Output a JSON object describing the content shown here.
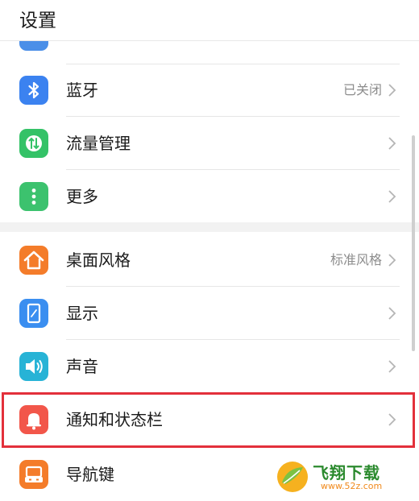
{
  "header": {
    "title": "设置"
  },
  "rows": [
    {
      "label": "蓝牙",
      "value": "已关闭",
      "icon": "bluetooth-icon",
      "color": "#3b82f0"
    },
    {
      "label": "流量管理",
      "value": "",
      "icon": "data-traffic-icon",
      "color": "#34c267"
    },
    {
      "label": "更多",
      "value": "",
      "icon": "more-dots-icon",
      "color": "#3cc26e"
    },
    {
      "label": "桌面风格",
      "value": "标准风格",
      "icon": "home-icon",
      "color": "#f47c2a"
    },
    {
      "label": "显示",
      "value": "",
      "icon": "display-icon",
      "color": "#3a8ef0"
    },
    {
      "label": "声音",
      "value": "",
      "icon": "speaker-icon",
      "color": "#27b3d6"
    },
    {
      "label": "通知和状态栏",
      "value": "",
      "icon": "bell-icon",
      "color": "#f2564a"
    },
    {
      "label": "导航键",
      "value": "",
      "icon": "navigation-key-icon",
      "color": "#f47c2a"
    }
  ],
  "highlight": {
    "color": "#e3303b",
    "row_label": "通知和状态栏"
  },
  "watermark": {
    "name": "飞翔下载",
    "url": "www.52z.com"
  }
}
